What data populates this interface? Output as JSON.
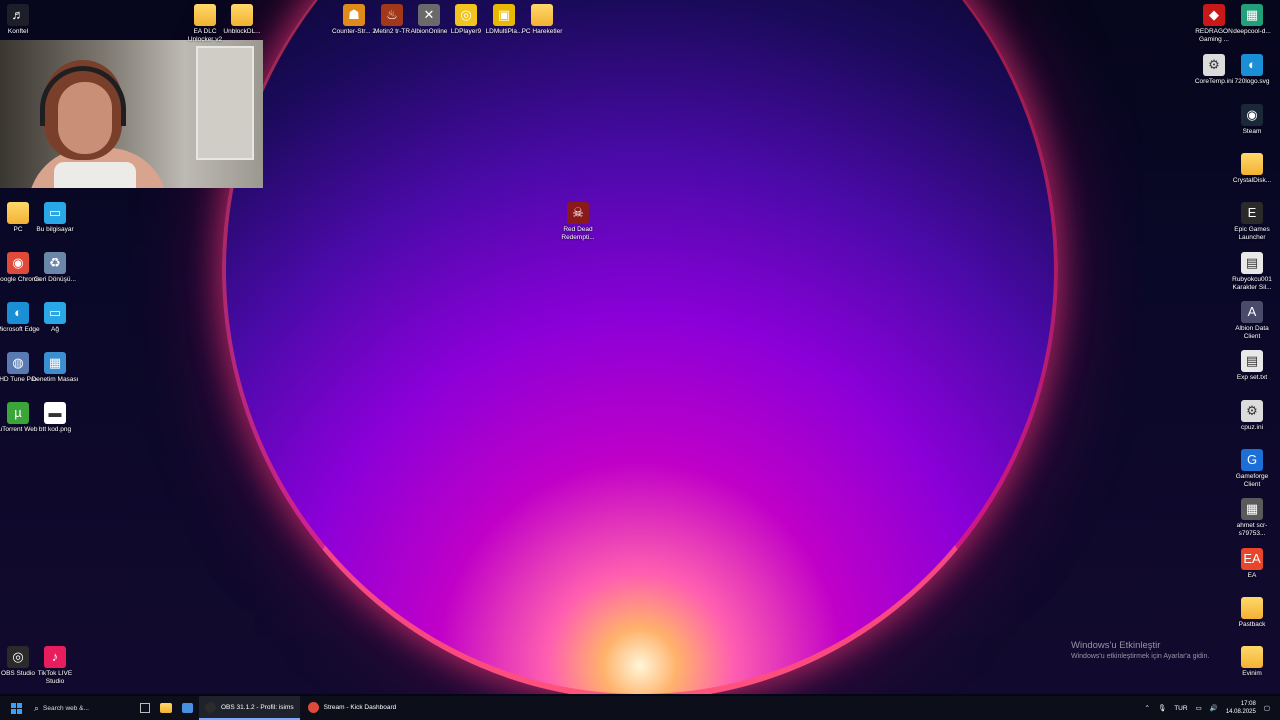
{
  "desktop": {
    "top_icons": [
      {
        "label": "Konftel",
        "glyph": "♬",
        "color": "#1e1e2a"
      },
      {
        "label": "EA DLC Unlocker v2",
        "glyph": "",
        "color": "folder"
      },
      {
        "label": "UnblockDL...",
        "glyph": "",
        "color": "folder"
      },
      {
        "label": "Counter-Str... 2",
        "glyph": "☗",
        "color": "#e08a1a"
      },
      {
        "label": "Metin2 tr-TR",
        "glyph": "♨",
        "color": "#a2381a"
      },
      {
        "label": "AlbionOnline",
        "glyph": "✕",
        "color": "#6a6a6a"
      },
      {
        "label": "LDPlayer9",
        "glyph": "◎",
        "color": "#f2c420"
      },
      {
        "label": "LDMultiPla...",
        "glyph": "▣",
        "color": "#e9b800"
      },
      {
        "label": "PC Hareketler",
        "glyph": "",
        "color": "folder"
      }
    ],
    "left_icons": [
      {
        "label": "PC",
        "glyph": "",
        "color": "folder"
      },
      {
        "label": "Bu bilgisayar",
        "glyph": "▭",
        "color": "#2aa7e6"
      },
      {
        "label": "Google Chrome",
        "glyph": "◉",
        "color": "#e04a3a"
      },
      {
        "label": "Geri Dönüşü...",
        "glyph": "♻",
        "color": "#6a86a8"
      },
      {
        "label": "Microsoft Edge",
        "glyph": "◐",
        "color": "#1b8fd6"
      },
      {
        "label": "Ağ",
        "glyph": "▭",
        "color": "#2aa7e6"
      },
      {
        "label": "HD Tune Pro",
        "glyph": "◍",
        "color": "#5a7ab2"
      },
      {
        "label": "Denetim Masası",
        "glyph": "▦",
        "color": "#3b8ed0"
      },
      {
        "label": "uTorrent Web",
        "glyph": "µ",
        "color": "#3aa63a"
      },
      {
        "label": "btt kod.png",
        "glyph": "▬",
        "color": "#ffffff"
      }
    ],
    "center_icon": {
      "label": "Red Dead Redempti...",
      "glyph": "☠",
      "color": "#8a1a1a"
    },
    "bottom_left_icons": [
      {
        "label": "OBS Studio",
        "glyph": "◎",
        "color": "#2a2a2a"
      },
      {
        "label": "TikTok LIVE Studio",
        "glyph": "♪",
        "color": "#e81d5e"
      }
    ],
    "right_icons": [
      {
        "label": "REDRAGON Gaming ...",
        "glyph": "◆",
        "color": "#c81818"
      },
      {
        "label": "deepcool-d...",
        "glyph": "▦",
        "color": "#22a07a"
      },
      {
        "label": "CoreTemp.ini",
        "glyph": "⚙",
        "color": "#dcdcdc"
      },
      {
        "label": "720logo.svg",
        "glyph": "◐",
        "color": "#1b8fd6"
      },
      {
        "label": "Steam",
        "glyph": "◉",
        "color": "#1b2838"
      },
      {
        "label": "CrystalDisk...",
        "glyph": "",
        "color": "folder"
      },
      {
        "label": "Epic Games Launcher",
        "glyph": "E",
        "color": "#2a2a2a"
      },
      {
        "label": "Rubyokcu001 Karakter Sil...",
        "glyph": "▤",
        "color": "#e8e8e8"
      },
      {
        "label": "Albion Data Client",
        "glyph": "A",
        "color": "#4a4a6a"
      },
      {
        "label": "Exp set.txt",
        "glyph": "▤",
        "color": "#e8e8e8"
      },
      {
        "label": "cpuz.ini",
        "glyph": "⚙",
        "color": "#dcdcdc"
      },
      {
        "label": "Gameforge Client",
        "glyph": "G",
        "color": "#1b6fd6"
      },
      {
        "label": "ahmet scr-s79753...",
        "glyph": "▦",
        "color": "#5a5a5a"
      },
      {
        "label": "EA",
        "glyph": "EA",
        "color": "#e8452a"
      },
      {
        "label": "Pastback",
        "glyph": "",
        "color": "folder"
      },
      {
        "label": "Evinim",
        "glyph": "",
        "color": "folder"
      }
    ]
  },
  "watermark": {
    "line1": "Windows'u Etkinleştir",
    "line2": "Windows'u etkinleştirmek için Ayarlar'a gidin."
  },
  "taskbar": {
    "search_placeholder": "Search web &...",
    "apps": [
      {
        "label": "OBS 31.1.2 - Profil: isims",
        "color": "#2b2b2b",
        "active": true
      },
      {
        "label": "Stream - Kick Dashboard",
        "color": "#e04a3a",
        "active": false
      }
    ],
    "tray": {
      "lang": "TUR",
      "time": "17:08",
      "date": "14.08.2025"
    }
  }
}
